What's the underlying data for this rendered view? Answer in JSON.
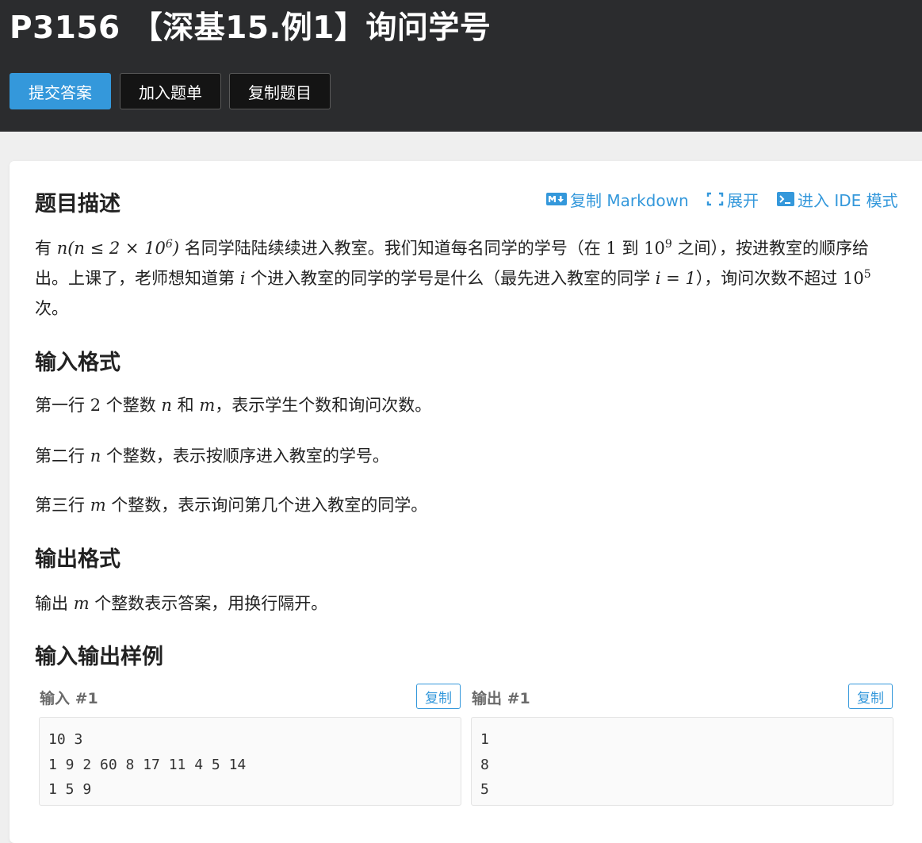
{
  "header": {
    "title": "P3156 【深基15.例1】询问学号",
    "buttons": {
      "submit": "提交答案",
      "add_list": "加入题单",
      "copy_problem": "复制题目"
    }
  },
  "toolbar": {
    "copy_markdown": "复制 Markdown",
    "expand": "展开",
    "ide_mode": "进入 IDE 模式"
  },
  "sections": {
    "description": {
      "title": "题目描述",
      "p1_a": "有 ",
      "p1_math1": "n(n ≤ 2 × 10",
      "p1_math1_exp": "6",
      "p1_math1_end": ")",
      "p1_b": " 名同学陆陆续续进入教室。我们知道每名同学的学号（在 ",
      "p1_math2": "1",
      "p1_c": " 到 ",
      "p1_math3": "10",
      "p1_math3_exp": "9",
      "p1_d": " 之间），按进教室的顺序给出。上课了，老师想知道第 ",
      "p1_math4": "i",
      "p1_e": " 个进入教室的同学的学号是什么（最先进入教室的同学 ",
      "p1_math5": "i = 1",
      "p1_f": "），询问次数不超过 ",
      "p1_math6": "10",
      "p1_math6_exp": "5",
      "p1_g": " 次。"
    },
    "input_format": {
      "title": "输入格式",
      "l1_a": "第一行 ",
      "l1_m1": "2",
      "l1_b": " 个整数 ",
      "l1_m2": "n",
      "l1_c": " 和 ",
      "l1_m3": "m",
      "l1_d": "，表示学生个数和询问次数。",
      "l2_a": "第二行 ",
      "l2_m1": "n",
      "l2_b": " 个整数，表示按顺序进入教室的学号。",
      "l3_a": "第三行 ",
      "l3_m1": "m",
      "l3_b": " 个整数，表示询问第几个进入教室的同学。"
    },
    "output_format": {
      "title": "输出格式",
      "l1_a": "输出 ",
      "l1_m1": "m",
      "l1_b": " 个整数表示答案，用换行隔开。"
    },
    "samples": {
      "title": "输入输出样例",
      "input_label": "输入 #1",
      "output_label": "输出 #1",
      "copy_label": "复制",
      "input_text": "10 3\n1 9 2 60 8 17 11 4 5 14\n1 5 9",
      "output_text": "1\n8\n5"
    }
  },
  "colors": {
    "header_bg": "#2b2c2e",
    "accent": "#3498db",
    "page_bg": "#efefef"
  },
  "icons": [
    "markdown-icon",
    "expand-icon",
    "terminal-icon"
  ]
}
